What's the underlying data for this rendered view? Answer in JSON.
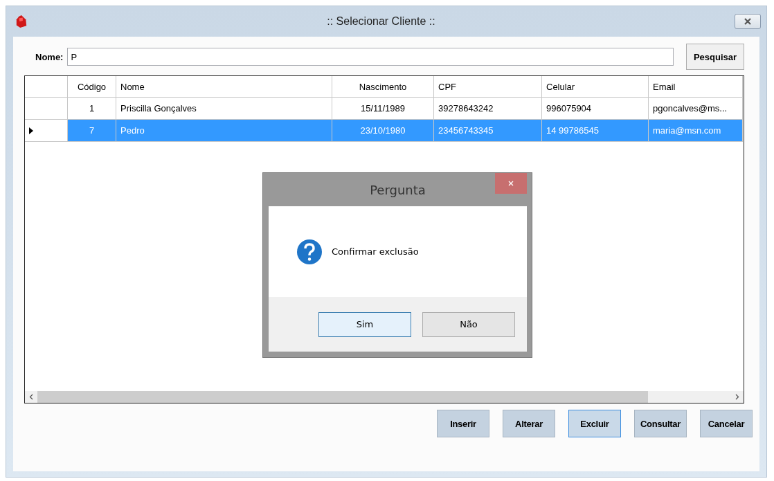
{
  "window": {
    "title": ":: Selecionar Cliente ::"
  },
  "search": {
    "label": "Nome:",
    "value": "P",
    "button": "Pesquisar"
  },
  "table": {
    "columns": [
      "Código",
      "Nome",
      "Nascimento",
      "CPF",
      "Celular",
      "Email"
    ],
    "rows": [
      {
        "selected": false,
        "cells": [
          "1",
          "Priscilla Gonçalves",
          "15/11/1989",
          "39278643242",
          "996075904",
          "pgoncalves@ms..."
        ]
      },
      {
        "selected": true,
        "cells": [
          "7",
          "Pedro",
          "23/10/1980",
          "23456743345",
          "14 99786545",
          "maria@msn.com"
        ]
      }
    ]
  },
  "buttons": [
    {
      "label": "Inserir",
      "focused": false
    },
    {
      "label": "Alterar",
      "focused": false
    },
    {
      "label": "Excluir",
      "focused": true
    },
    {
      "label": "Consultar",
      "focused": false
    },
    {
      "label": "Cancelar",
      "focused": false
    }
  ],
  "dialog": {
    "title": "Pergunta",
    "message": "Confirmar exclusão",
    "buttons": [
      {
        "label": "Sim",
        "focused": true
      },
      {
        "label": "Não",
        "focused": false
      }
    ]
  }
}
